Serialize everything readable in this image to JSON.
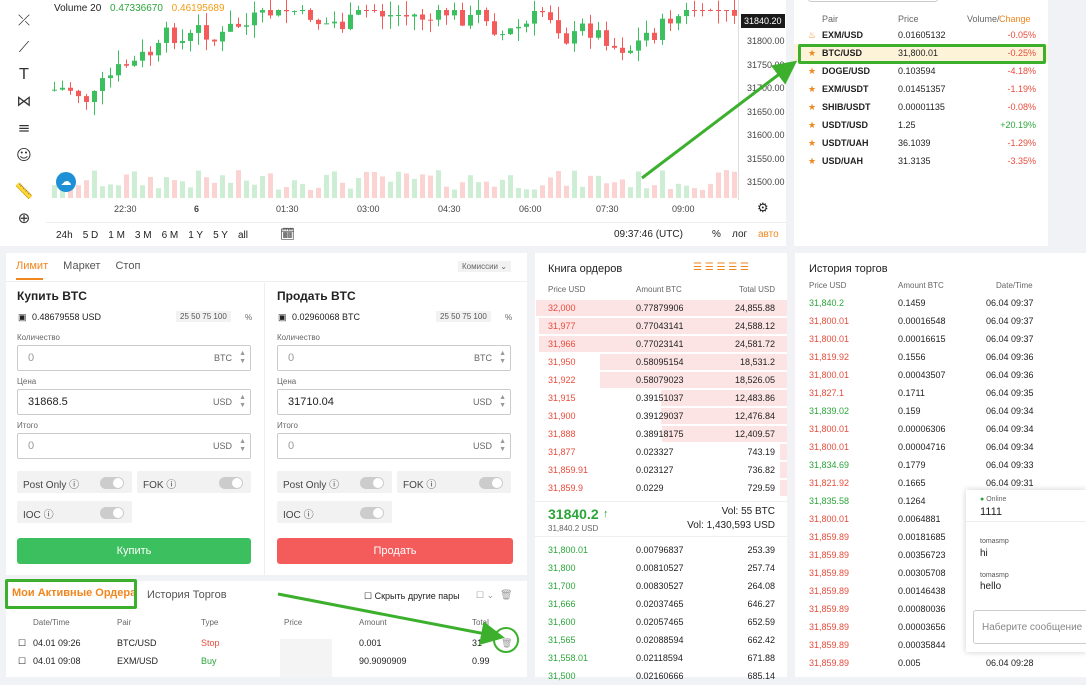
{
  "chart": {
    "volume_label": "Volume 20",
    "vol1": "0.47336670",
    "vol2": "0.46195689",
    "price_tag": "31840.20",
    "y_ticks": [
      "31800.00",
      "31750.00",
      "31700.00",
      "31650.00",
      "31600.00",
      "31550.00",
      "31500.00"
    ],
    "x_ticks": [
      "22:30",
      "6",
      "01:30",
      "03:00",
      "04:30",
      "06:00",
      "07:30",
      "09:00"
    ],
    "ranges": [
      "24h",
      "5 D",
      "1 M",
      "3 M",
      "6 M",
      "1 Y",
      "5 Y",
      "all"
    ],
    "clock": "09:37:46 (UTC)",
    "pct": "%",
    "log": "лог",
    "auto": "авто"
  },
  "pairs": {
    "headers": {
      "pair": "Pair",
      "price": "Price",
      "vol": "Volume/",
      "change": "Change"
    },
    "rows": [
      {
        "pair": "EXM/USD",
        "price": "0.01605132",
        "change": "-0.05%",
        "up": false
      },
      {
        "pair": "BTC/USD",
        "price": "31,800.01",
        "change": "-0.25%",
        "up": false
      },
      {
        "pair": "DOGE/USD",
        "price": "0.103594",
        "change": "-4.18%",
        "up": false
      },
      {
        "pair": "EXM/USDT",
        "price": "0.01451357",
        "change": "-1.19%",
        "up": false
      },
      {
        "pair": "SHIB/USDT",
        "price": "0.00001135",
        "change": "-0.08%",
        "up": false
      },
      {
        "pair": "USDT/USD",
        "price": "1.25",
        "change": "+20.19%",
        "up": true
      },
      {
        "pair": "USDT/UAH",
        "price": "36.1039",
        "change": "-1.29%",
        "up": false
      },
      {
        "pair": "USD/UAH",
        "price": "31.3135",
        "change": "-3.35%",
        "up": false
      }
    ]
  },
  "trade": {
    "tabs": [
      "Лимит",
      "Маркет",
      "Стоп"
    ],
    "fees": "Комиссии",
    "buy": {
      "title": "Купить BTC",
      "balance": "0.48679558 USD",
      "qty_label": "Количество",
      "qty": "0",
      "qty_unit": "BTC",
      "price_label": "Цена",
      "price": "31868.5",
      "price_unit": "USD",
      "total_label": "Итого",
      "total": "0",
      "total_unit": "USD",
      "btn": "Купить"
    },
    "sell": {
      "title": "Продать BTC",
      "balance": "0.02960068 BTC",
      "qty_label": "Количество",
      "qty": "0",
      "qty_unit": "BTC",
      "price_label": "Цена",
      "price": "31710.04",
      "price_unit": "USD",
      "total_label": "Итого",
      "total": "0",
      "total_unit": "USD",
      "btn": "Продать"
    },
    "pcts": [
      "25",
      "50",
      "75",
      "100"
    ],
    "pct_sign": "%",
    "opts": {
      "post_only": "Post Only",
      "fok": "FOK",
      "ioc": "IOC"
    }
  },
  "orders": {
    "tab_active": "Мои Активные Ордера",
    "tab_history": "История Торгов",
    "hide": "Скрыть другие пары",
    "headers": [
      "Date/Time",
      "Pair",
      "Type",
      "Price",
      "Amount",
      "Total"
    ],
    "rows": [
      {
        "date": "04.01 09:26",
        "pair": "BTC/USD",
        "type": "Stop",
        "amount": "0.001",
        "total": "31"
      },
      {
        "date": "04.01 09:08",
        "pair": "EXM/USD",
        "type": "Buy",
        "amount": "90.9090909",
        "total": "0.99"
      }
    ]
  },
  "book": {
    "title": "Книга ордеров",
    "headers": [
      "Price USD",
      "Amount BTC",
      "Total USD"
    ],
    "asks": [
      [
        "32,000",
        "0.77879906",
        "24,855.88"
      ],
      [
        "31,977",
        "0.77043141",
        "24,588.12"
      ],
      [
        "31,966",
        "0.77023141",
        "24,581.72"
      ],
      [
        "31,950",
        "0.58095154",
        "18,531.2"
      ],
      [
        "31,922",
        "0.58079023",
        "18,526.05"
      ],
      [
        "31,915",
        "0.39151037",
        "12,483.86"
      ],
      [
        "31,900",
        "0.39129037",
        "12,476.84"
      ],
      [
        "31,888",
        "0.38918175",
        "12,409.57"
      ],
      [
        "31,877",
        "0.023327",
        "743.19"
      ],
      [
        "31,859.91",
        "0.023127",
        "736.82"
      ],
      [
        "31,859.9",
        "0.0229",
        "729.59"
      ]
    ],
    "last": "31840.2",
    "last_sub": "31,840.2 USD",
    "vol_btc": "Vol: 55 BTC",
    "vol_usd": "Vol: 1,430,593 USD",
    "bids": [
      [
        "31,800.01",
        "0.00796837",
        "253.39"
      ],
      [
        "31,800",
        "0.00810527",
        "257.74"
      ],
      [
        "31,700",
        "0.00830527",
        "264.08"
      ],
      [
        "31,666",
        "0.02037465",
        "646.27"
      ],
      [
        "31,600",
        "0.02057465",
        "652.59"
      ],
      [
        "31,565",
        "0.02088594",
        "662.42"
      ],
      [
        "31,558.01",
        "0.02118594",
        "671.88"
      ],
      [
        "31,500",
        "0.02160666",
        "685.14"
      ]
    ]
  },
  "history": {
    "title": "История торгов",
    "headers": [
      "Price USD",
      "Amount BTC",
      "Date/Time"
    ],
    "rows": [
      [
        "31,840.2",
        "0.1459",
        "06.04 09:37",
        true
      ],
      [
        "31,800.01",
        "0.00016548",
        "06.04 09:37",
        false
      ],
      [
        "31,800.01",
        "0.00016615",
        "06.04 09:37",
        false
      ],
      [
        "31,819.92",
        "0.1556",
        "06.04 09:36",
        false
      ],
      [
        "31,800.01",
        "0.00043507",
        "06.04 09:36",
        false
      ],
      [
        "31,827.1",
        "0.1711",
        "06.04 09:35",
        false
      ],
      [
        "31,839.02",
        "0.159",
        "06.04 09:34",
        true
      ],
      [
        "31,800.01",
        "0.00006306",
        "06.04 09:34",
        false
      ],
      [
        "31,800.01",
        "0.00004716",
        "06.04 09:34",
        false
      ],
      [
        "31,834.69",
        "0.1779",
        "06.04 09:33",
        true
      ],
      [
        "31,821.92",
        "0.1665",
        "06.04 09:31",
        false
      ],
      [
        "31,835.58",
        "0.1264",
        "",
        true
      ],
      [
        "31,800.01",
        "0.0064881",
        "",
        false
      ],
      [
        "31,859.89",
        "0.00181685",
        "",
        false
      ],
      [
        "31,859.89",
        "0.00356723",
        "",
        false
      ],
      [
        "31,859.89",
        "0.00305708",
        "",
        false
      ],
      [
        "31,859.89",
        "0.00146438",
        "",
        false
      ],
      [
        "31,859.89",
        "0.00080036",
        "",
        false
      ],
      [
        "31,859.89",
        "0.00003656",
        "",
        false
      ],
      [
        "31,859.89",
        "0.00035844",
        "",
        false
      ],
      [
        "31,859.89",
        "0.005",
        "06.04 09:28",
        false
      ]
    ]
  },
  "chat": {
    "online": "Online",
    "room": "1111",
    "msgs": [
      {
        "user": "tomasmp",
        "text": "hi"
      },
      {
        "user": "tomasmp",
        "text": "hello"
      }
    ],
    "placeholder": "Наберите сообщение"
  }
}
